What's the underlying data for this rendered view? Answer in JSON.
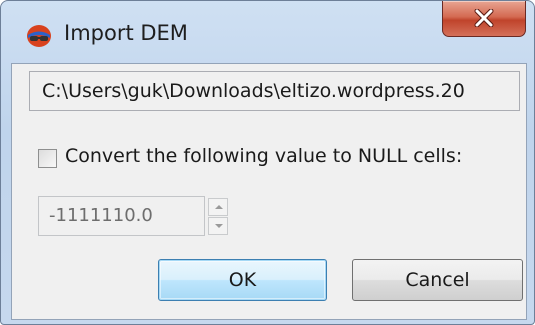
{
  "window": {
    "title": "Import DEM",
    "app_icon": "import-dem-app-icon",
    "close_icon": "close-icon"
  },
  "form": {
    "path_value": "C:\\Users\\guk\\Downloads\\eltizo.wordpress.20",
    "convert_null_checked": false,
    "convert_null_label": "Convert the following value to NULL cells:",
    "null_value": "-1111110.0"
  },
  "buttons": {
    "ok_label": "OK",
    "cancel_label": "Cancel"
  },
  "colors": {
    "close_button": "#c9523a",
    "ok_button_border": "#3c7fb1",
    "dialog_background": "#f0f0f0"
  }
}
